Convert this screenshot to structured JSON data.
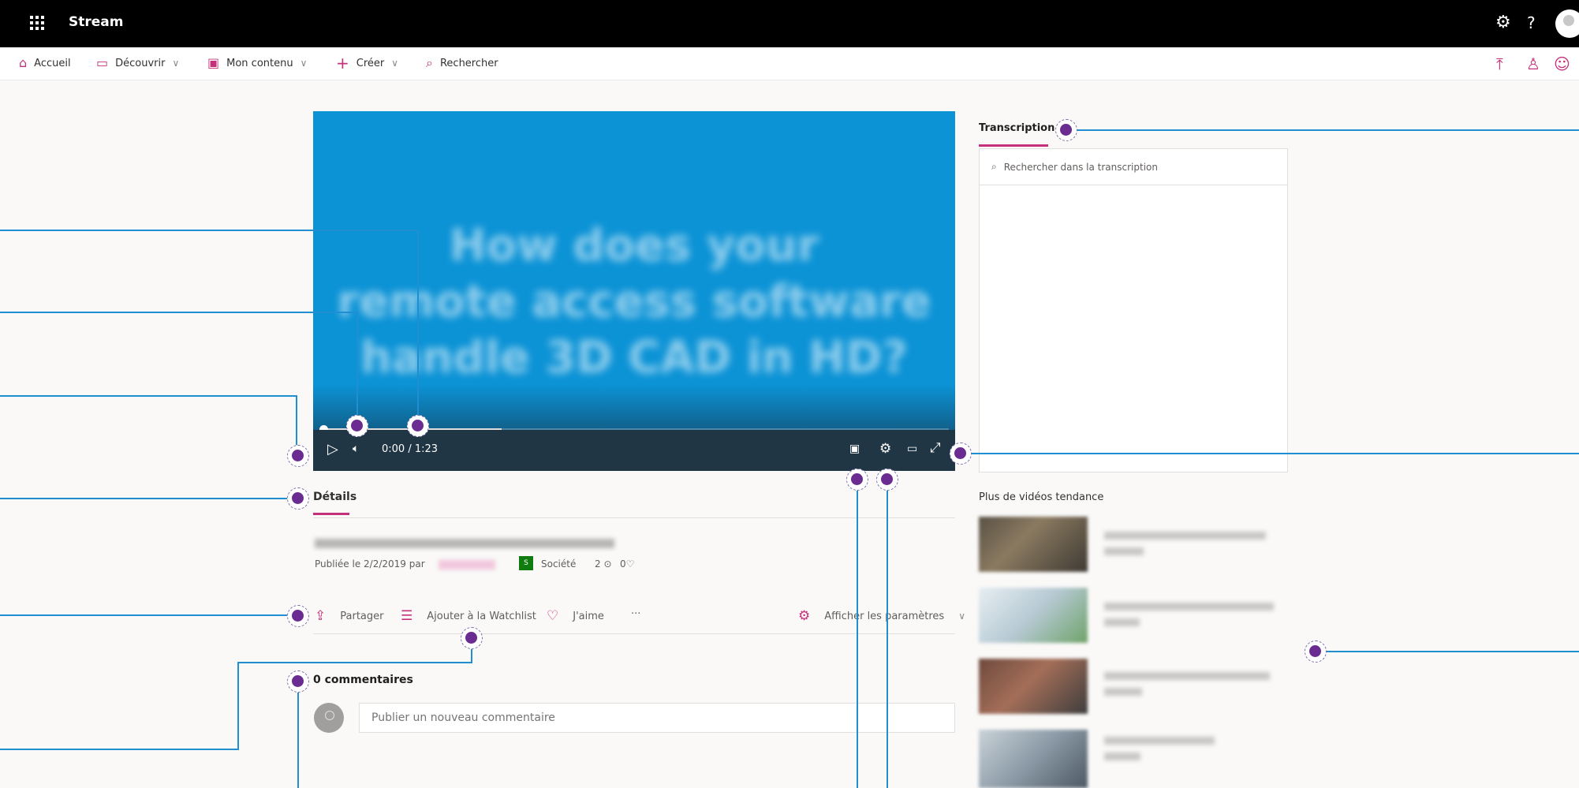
{
  "topbar": {
    "app_title": "Stream",
    "icons": [
      "waffle-icon",
      "gear-icon",
      "help-icon",
      "avatar"
    ],
    "help_label": "?"
  },
  "nav": {
    "items": [
      {
        "label": "Accueil",
        "icon": "home-icon"
      },
      {
        "label": "Découvrir",
        "icon": "discover-icon"
      },
      {
        "label": "Mon contenu",
        "icon": "my-content-icon"
      },
      {
        "label": "Créer",
        "icon": "plus-icon"
      },
      {
        "label": "Rechercher",
        "icon": "search-icon"
      }
    ],
    "right_icons": [
      "upload-icon",
      "people-icon",
      "smiley-icon"
    ]
  },
  "video": {
    "overlay_text_line1": "How does your",
    "overlay_text_line2": "remote access software",
    "overlay_text_line3": "handle 3D CAD in HD?",
    "time_current": "0:00",
    "time_separator": "/",
    "time_total": "1:23",
    "progress_fraction": 0.29
  },
  "details": {
    "tab_label": "Détails",
    "published_text": "Publiée le 2/2/2019 par",
    "company_label": "Société",
    "views_count": "2",
    "likes_count": "0"
  },
  "actions": {
    "share": "Partager",
    "watchlist": "Ajouter à la Watchlist",
    "like": "J'aime",
    "more": "···",
    "settings": "Afficher les paramètres"
  },
  "comments": {
    "title": "0 commentaires",
    "placeholder": "Publier un nouveau commentaire"
  },
  "transcript": {
    "tab_label": "Transcription",
    "search_placeholder": "Rechercher dans la transcription"
  },
  "trending": {
    "title": "Plus de vidéos tendance"
  },
  "colors": {
    "accent": "#c4317a",
    "video_bg": "#0c93d6",
    "topbar": "#000000",
    "annotation_line": "#1f8fd1",
    "annotation_marker": "#6b2c91"
  }
}
